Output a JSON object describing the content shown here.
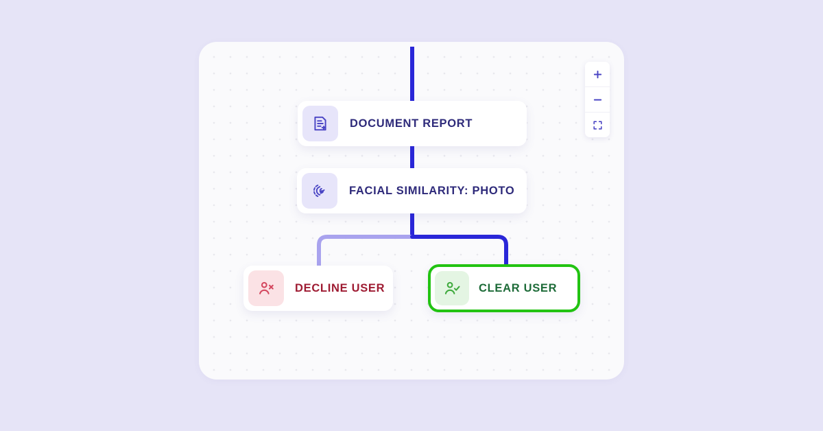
{
  "page": {
    "background_color": "#e6e4f7"
  },
  "canvas": {
    "background_color": "#fafafc",
    "grid": "dot-grid"
  },
  "colors": {
    "active_edge": "#2a27d8",
    "inactive_edge": "#a9a3ee",
    "node_text_indigo": "#2e2a7a",
    "decline_text": "#9e1b32",
    "clear_text": "#1d6b38",
    "selected_border": "#22c312",
    "icon_tile_indigo": "#e7e5fa",
    "icon_tile_red": "#fbe2e5",
    "icon_tile_green": "#e4f5e3"
  },
  "nodes": [
    {
      "id": "document-report",
      "label": "DOCUMENT REPORT",
      "icon": "document-report-icon",
      "state": "default"
    },
    {
      "id": "facial-similarity",
      "label": "FACIAL SIMILARITY: PHOTO",
      "icon": "face-scan-icon",
      "state": "default"
    },
    {
      "id": "decline-user",
      "label": "DECLINE USER",
      "icon": "user-decline-icon",
      "state": "inactive"
    },
    {
      "id": "clear-user",
      "label": "CLEAR USER",
      "icon": "user-approve-icon",
      "state": "selected"
    }
  ],
  "zoom_controls": {
    "zoom_in_label": "+",
    "zoom_out_label": "−",
    "fit_label": "fit-to-screen"
  }
}
